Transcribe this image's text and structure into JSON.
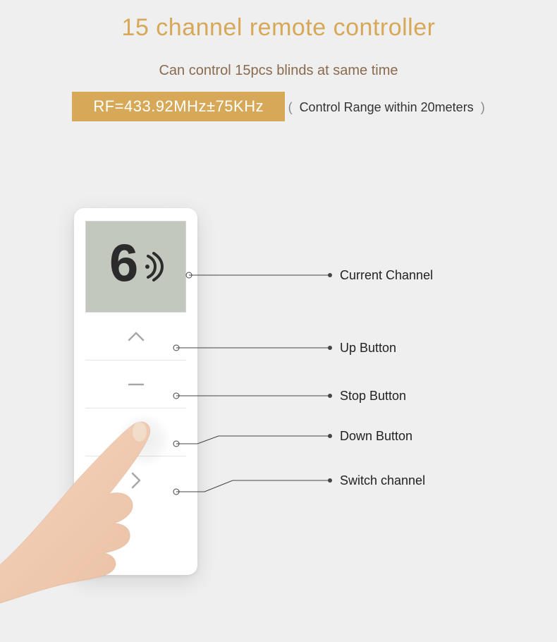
{
  "header": {
    "title": "15 channel remote controller",
    "subtitle": "Can control 15pcs blinds at same time",
    "rf_badge": "RF=433.92MHz±75KHz",
    "range": "Control Range within 20meters"
  },
  "remote": {
    "current_channel": "6"
  },
  "callouts": {
    "current_channel": "Current Channel",
    "up_button": "Up Button",
    "stop_button": "Stop Button",
    "down_button": "Down Button",
    "switch_channel": "Switch channel"
  }
}
